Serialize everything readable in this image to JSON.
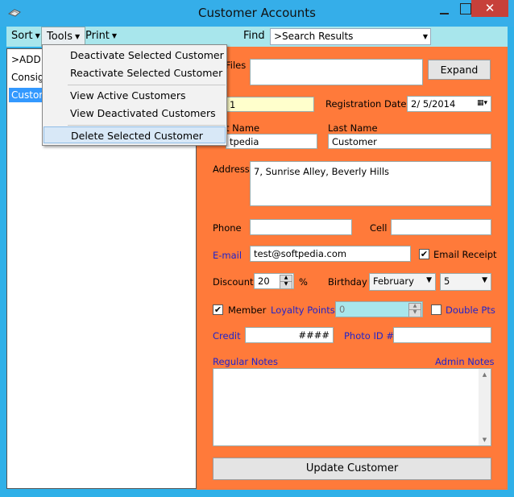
{
  "window": {
    "title": "Customer Accounts",
    "close_glyph": "✕"
  },
  "toolbar": {
    "sort_label": "Sort",
    "tools_label": "Tools",
    "print_label": "Print",
    "find_label": "Find",
    "search_value": ">Search Results"
  },
  "list": {
    "items": [
      ">ADD N",
      "Consign",
      "Custome"
    ]
  },
  "menu": {
    "items": [
      "Deactivate Selected Customer",
      "Reactivate Selected Customer",
      "View Active Customers",
      "View Deactivated Customers",
      "Delete Selected Customer"
    ]
  },
  "form": {
    "files_label": "Files",
    "expand_label": "Expand",
    "account_id": "1",
    "registration_label": "Registration Date",
    "registration_date": "2/ 5/2014",
    "first_name_label": "t Name",
    "first_name": "tpedia",
    "last_name_label": "Last Name",
    "last_name": "Customer",
    "address_label": "Address",
    "address": "7, Sunrise Alley, Beverly Hills",
    "phone_label": "Phone",
    "phone": "",
    "cell_label": "Cell",
    "cell": "",
    "email_label": "E-mail",
    "email": "test@softpedia.com",
    "email_receipt_label": "Email Receipt",
    "email_receipt_checked": true,
    "discount_label": "Discount",
    "discount": "20",
    "percent": "%",
    "birthday_label": "Birthday",
    "birthday_month": "February",
    "birthday_day": "5",
    "member_label": "Member",
    "member_checked": true,
    "loyalty_label": "Loyalty Points",
    "loyalty_points": "0",
    "double_pts_label": "Double Pts",
    "double_pts_checked": false,
    "credit_label": "Credit",
    "credit": "####",
    "photo_id_label": "Photo ID #",
    "photo_id": "",
    "regular_notes_label": "Regular Notes",
    "admin_notes_label": "Admin Notes",
    "notes": "",
    "update_label": "Update Customer"
  },
  "colors": {
    "titlebar": "#35aee9",
    "panel": "#ff7a3a",
    "accent_blue": "#1f24cc",
    "selection": "#3399ff"
  }
}
